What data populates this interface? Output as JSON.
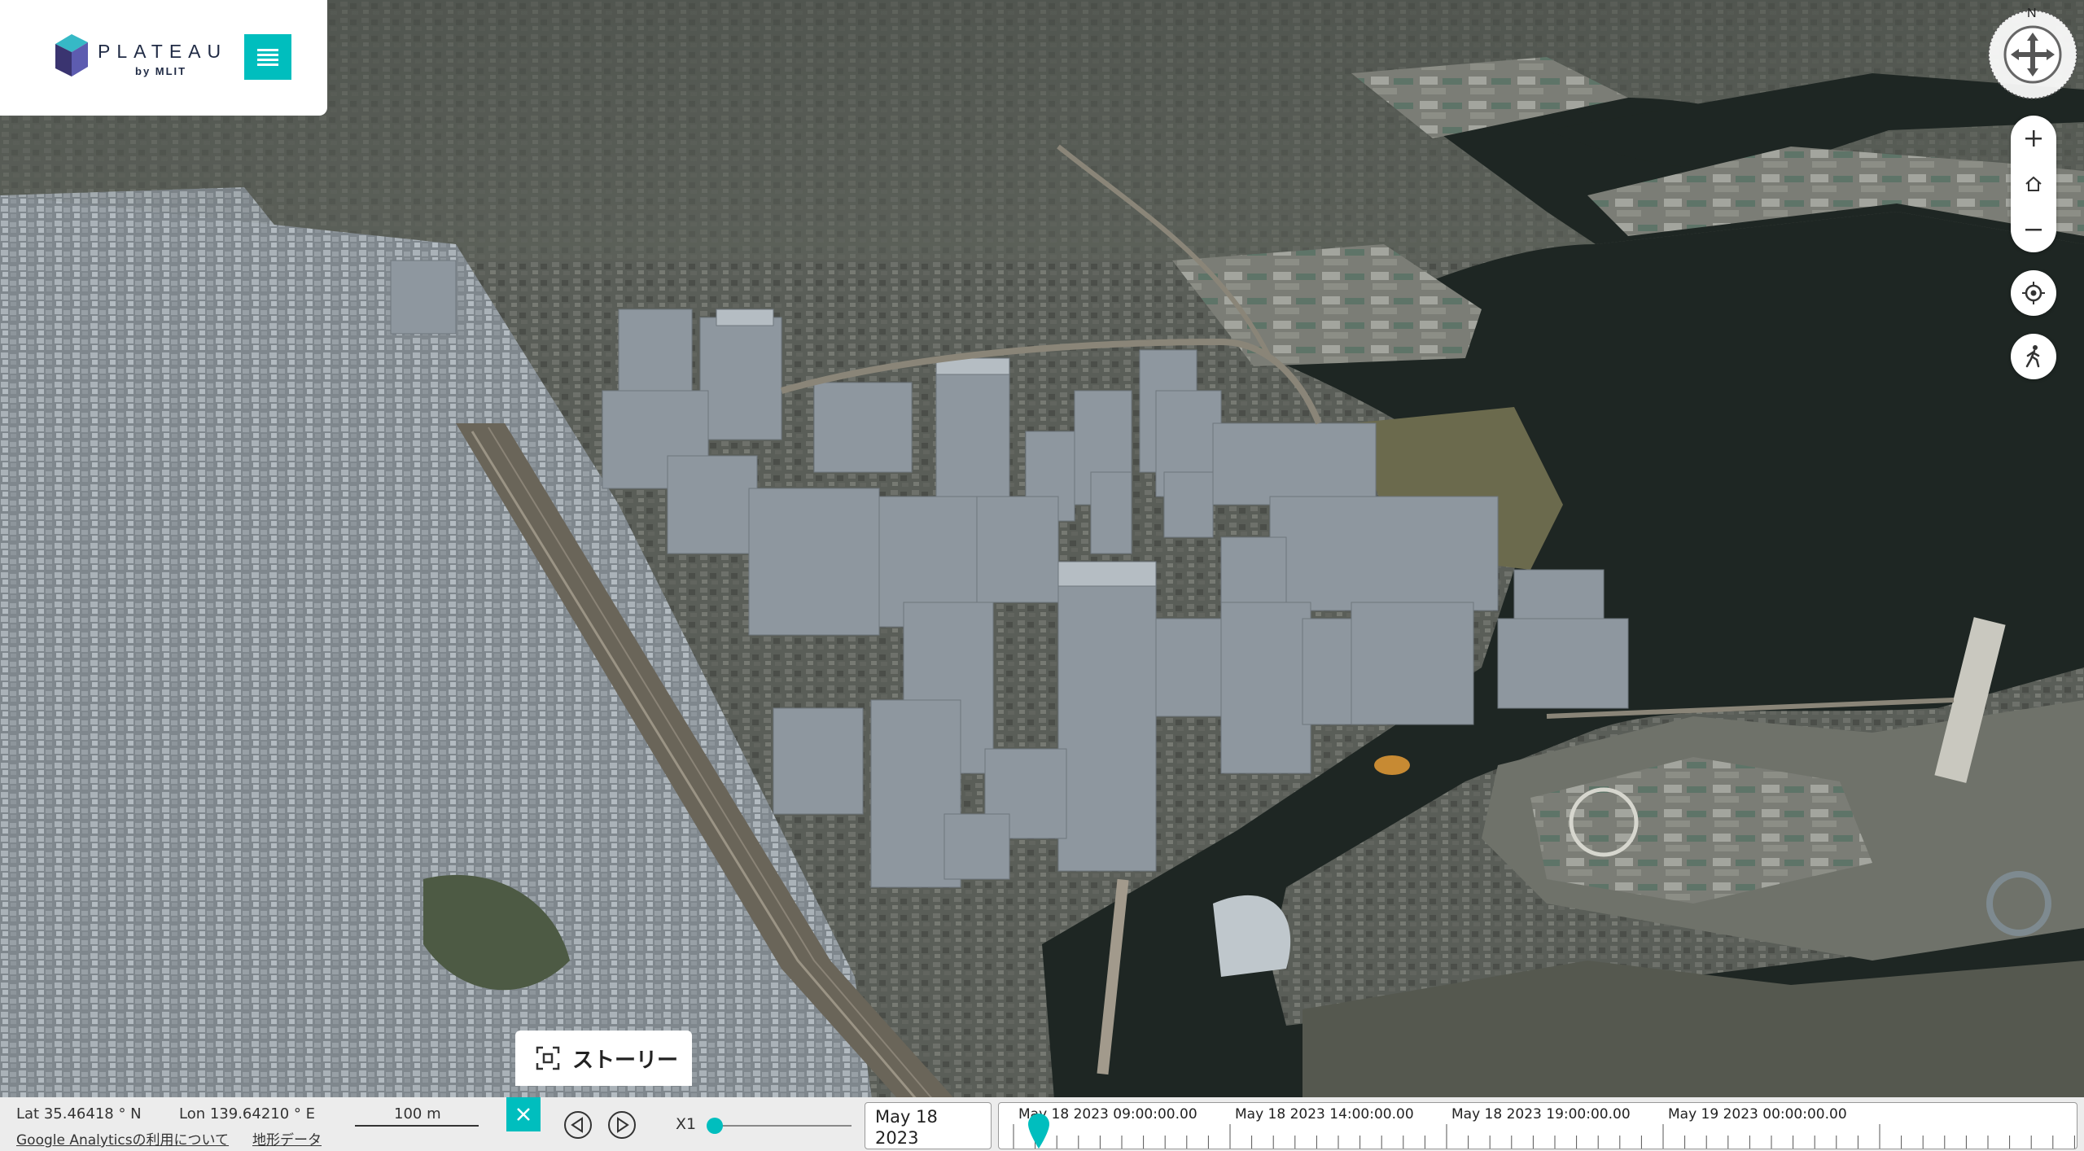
{
  "logo": {
    "word": "PLATEAU",
    "sub": "by MLIT"
  },
  "compass": {
    "north_label": "N"
  },
  "story": {
    "label": "ストーリー"
  },
  "status": {
    "lat": "Lat 35.46418 ° N",
    "lon": "Lon 139.64210 ° E",
    "scale": "100 m",
    "analytics_link": "Google Analyticsの利用について",
    "terrain_link": "地形データ"
  },
  "timeline": {
    "speed": "X1",
    "current_date_line1": "May 18",
    "current_date_line2": "2023",
    "labels": [
      "May 18 2023 09:00:00.00",
      "May 18 2023 14:00:00.00",
      "May 18 2023 19:00:00.00",
      "May 19 2023 00:00:00.00"
    ]
  },
  "colors": {
    "accent": "#00bebe",
    "water": "#1e2623",
    "buildings": "#97a0a8"
  }
}
